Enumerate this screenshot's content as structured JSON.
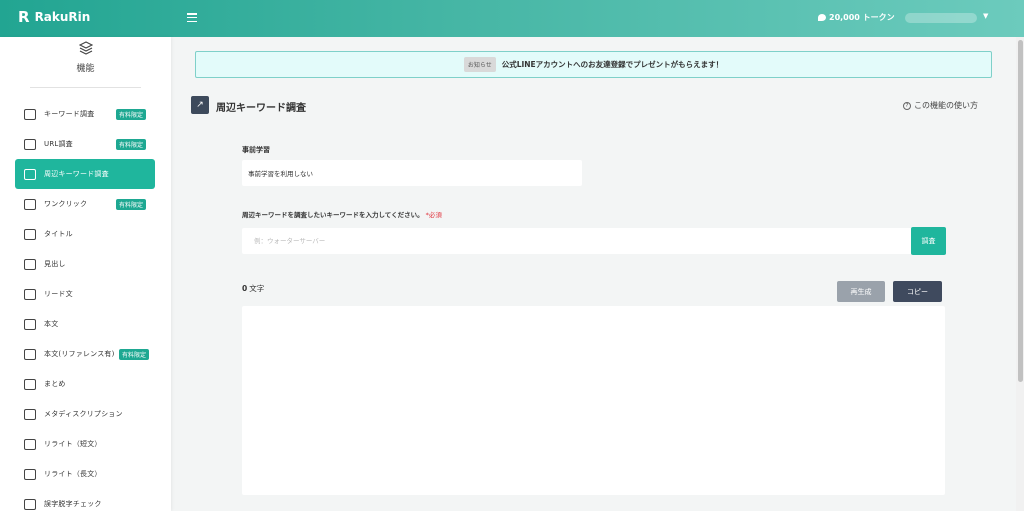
{
  "app": {
    "logo_mark": "R",
    "name": "RakuRin"
  },
  "header": {
    "tokens": "20,000 トークン"
  },
  "sidebar": {
    "heading": "機能",
    "items": [
      {
        "label": "キーワード調査",
        "badge": "有料限定",
        "icon": "keyword-search-icon"
      },
      {
        "label": "URL調査",
        "badge": "有料限定",
        "icon": "url-search-icon"
      },
      {
        "label": "周辺キーワード調査",
        "badge": "",
        "icon": "related-keyword-icon",
        "active": true
      },
      {
        "label": "ワンクリック",
        "badge": "有料限定",
        "icon": "one-click-icon"
      },
      {
        "label": "タイトル",
        "badge": "",
        "icon": "title-icon"
      },
      {
        "label": "見出し",
        "badge": "",
        "icon": "heading-icon"
      },
      {
        "label": "リード文",
        "badge": "",
        "icon": "lead-icon"
      },
      {
        "label": "本文",
        "badge": "",
        "icon": "body-text-icon"
      },
      {
        "label": "本文(リファレンス有)",
        "badge": "有料限定",
        "icon": "body-reference-icon"
      },
      {
        "label": "まとめ",
        "badge": "",
        "icon": "summary-icon"
      },
      {
        "label": "メタディスクリプション",
        "badge": "",
        "icon": "meta-description-icon"
      },
      {
        "label": "リライト（短文）",
        "badge": "",
        "icon": "rewrite-short-icon"
      },
      {
        "label": "リライト（長文）",
        "badge": "",
        "icon": "rewrite-long-icon"
      },
      {
        "label": "誤字脱字チェック",
        "badge": "",
        "icon": "typo-check-icon"
      }
    ]
  },
  "notice": {
    "tag": "お知らせ",
    "text": "公式LINEアカウントへのお友達登録でプレゼントがもらえます！"
  },
  "page": {
    "icon_glyph": "↗",
    "title": "周辺キーワード調査",
    "help": "この機能の使い方"
  },
  "form": {
    "pretraining_label": "事前学習",
    "pretraining_value": "事前学習を利用しない",
    "keyword_label": "周辺キーワードを調査したいキーワードを入力してください。",
    "required": "*必須",
    "keyword_placeholder": "例：ウォーターサーバー",
    "search_button": "調査",
    "char_count": "0",
    "char_unit": "文字",
    "regenerate_button": "再生成",
    "copy_button": "コピー"
  },
  "colors": {
    "accent": "#1fb69d",
    "header_start": "#22a592",
    "header_end": "#6ccbbd",
    "dark_button": "#3f4a5e"
  }
}
